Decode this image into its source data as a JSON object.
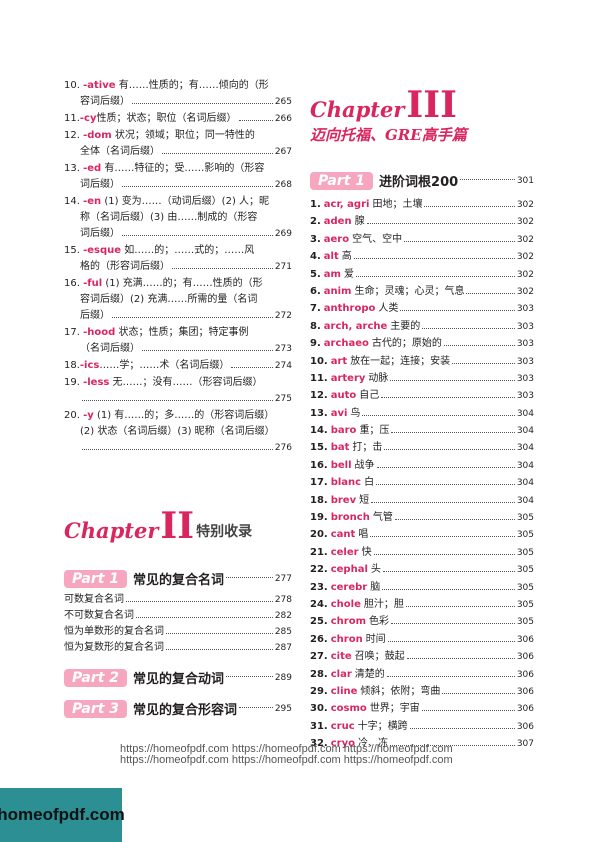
{
  "left_entries": [
    {
      "num": "10.",
      "affix": "-ative",
      "line1": "有……性质的；有……倾向的（形",
      "line2": "容词后缀）",
      "page": "265"
    },
    {
      "num": "11.",
      "affix": "-cy",
      "line1": "性质；状态；职位（名词后缀）",
      "line2": "",
      "page": "266"
    },
    {
      "num": "12.",
      "affix": "-dom",
      "line1": "状况；领域；职位；同一特性的",
      "line2": "全体（名词后缀）",
      "page": "267"
    },
    {
      "num": "13.",
      "affix": "-ed",
      "line1": "有……特征的；受……影响的（形容",
      "line2": "词后缀）",
      "page": "268"
    },
    {
      "num": "14.",
      "affix": "-en",
      "line1": "(1) 变为……（动词后缀）(2) 人；昵",
      "line2": "称（名词后缀）(3) 由……制成的（形容",
      "line3": "词后缀）",
      "page": "269"
    },
    {
      "num": "15.",
      "affix": "-esque",
      "line1": "如……的；……式的；……风",
      "line2": "格的（形容词后缀）",
      "page": "271"
    },
    {
      "num": "16.",
      "affix": "-ful",
      "line1": "(1) 充满……的；有……性质的（形",
      "line2": "容词后缀）(2) 充满……所需的量（名词",
      "line3": "后缀）",
      "page": "272"
    },
    {
      "num": "17.",
      "affix": "-hood",
      "line1": "状态；性质；集团；特定事例",
      "line2": "（名词后缀）",
      "page": "273"
    },
    {
      "num": "18.",
      "affix": "-ics",
      "line1": "……学；……术（名词后缀）",
      "line2": "",
      "page": "274"
    },
    {
      "num": "19.",
      "affix": "-less",
      "line1": "无……；没有……（形容词后缀）",
      "line2": "",
      "page": "275",
      "page_own_line": true
    },
    {
      "num": "20.",
      "affix": "-y",
      "line1": "(1) 有……的；多……的（形容词后缀）",
      "line2": "(2) 状态（名词后缀）(3) 昵称（名词后缀）",
      "line3": "",
      "page": "276",
      "page_own_line": true
    }
  ],
  "chapter2": {
    "word": "Chapter",
    "roman": "II",
    "sub": "特别收录"
  },
  "chapter2_parts": [
    {
      "badge": "Part 1",
      "title": "常见的复合名词",
      "page": "277",
      "items": [
        {
          "text": "可数复合名词",
          "page": "278"
        },
        {
          "text": "不可数复合名词",
          "page": "282"
        },
        {
          "text": "恒为单数形的复合名词",
          "page": "285"
        },
        {
          "text": "恒为复数形的复合名词",
          "page": "287"
        }
      ]
    },
    {
      "badge": "Part 2",
      "title": "常见的复合动词",
      "page": "289",
      "items": []
    },
    {
      "badge": "Part 3",
      "title": "常见的复合形容词",
      "page": "295",
      "items": []
    }
  ],
  "chapter3": {
    "word": "Chapter",
    "roman": "III",
    "sub": "迈向托福、GRE高手篇"
  },
  "chapter3_part": {
    "badge": "Part 1",
    "title": "进阶词根200",
    "page": "301"
  },
  "roots": [
    {
      "n": "1.",
      "root": "acr, agri",
      "meaning": "田地；土壤",
      "page": "302"
    },
    {
      "n": "2.",
      "root": "aden",
      "meaning": "腺",
      "page": "302"
    },
    {
      "n": "3.",
      "root": "aero",
      "meaning": "空气、空中",
      "page": "302"
    },
    {
      "n": "4.",
      "root": "alt",
      "meaning": "高",
      "page": "302"
    },
    {
      "n": "5.",
      "root": "am",
      "meaning": "爱",
      "page": "302"
    },
    {
      "n": "6.",
      "root": "anim",
      "meaning": "生命；灵魂；心灵；气息",
      "page": "302"
    },
    {
      "n": "7.",
      "root": "anthropo",
      "meaning": "人类",
      "page": "303"
    },
    {
      "n": "8.",
      "root": "arch, arche",
      "meaning": "主要的",
      "page": "303"
    },
    {
      "n": "9.",
      "root": "archaeo",
      "meaning": "古代的；原始的",
      "page": "303"
    },
    {
      "n": "10.",
      "root": "art",
      "meaning": "放在一起；连接；安装",
      "page": "303"
    },
    {
      "n": "11.",
      "root": "artery",
      "meaning": "动脉",
      "page": "303"
    },
    {
      "n": "12.",
      "root": "auto",
      "meaning": "自己",
      "page": "303"
    },
    {
      "n": "13.",
      "root": "avi",
      "meaning": "鸟",
      "page": "304"
    },
    {
      "n": "14.",
      "root": "baro",
      "meaning": "重；压",
      "page": "304"
    },
    {
      "n": "15.",
      "root": "bat",
      "meaning": "打；击",
      "page": "304"
    },
    {
      "n": "16.",
      "root": "bell",
      "meaning": "战争",
      "page": "304"
    },
    {
      "n": "17.",
      "root": "blanc",
      "meaning": "白",
      "page": "304"
    },
    {
      "n": "18.",
      "root": "brev",
      "meaning": "短",
      "page": "304"
    },
    {
      "n": "19.",
      "root": "bronch",
      "meaning": "气管",
      "page": "305"
    },
    {
      "n": "20.",
      "root": "cant",
      "meaning": "唱",
      "page": "305"
    },
    {
      "n": "21.",
      "root": "celer",
      "meaning": "快",
      "page": "305"
    },
    {
      "n": "22.",
      "root": "cephal",
      "meaning": "头",
      "page": "305"
    },
    {
      "n": "23.",
      "root": "cerebr",
      "meaning": "脑",
      "page": "305"
    },
    {
      "n": "24.",
      "root": "chole",
      "meaning": "胆汁；胆",
      "page": "305"
    },
    {
      "n": "25.",
      "root": "chrom",
      "meaning": "色彩",
      "page": "305"
    },
    {
      "n": "26.",
      "root": "chron",
      "meaning": "时间",
      "page": "306"
    },
    {
      "n": "27.",
      "root": "cite",
      "meaning": "召唤；鼓起",
      "page": "306"
    },
    {
      "n": "28.",
      "root": "clar",
      "meaning": "清楚的",
      "page": "306"
    },
    {
      "n": "29.",
      "root": "cline",
      "meaning": "倾斜；依附；弯曲",
      "page": "306"
    },
    {
      "n": "30.",
      "root": "cosmo",
      "meaning": "世界；宇宙",
      "page": "306"
    },
    {
      "n": "31.",
      "root": "cruc",
      "meaning": "十字；横跨",
      "page": "306"
    },
    {
      "n": "32.",
      "root": "cryo",
      "meaning": "冷、冻",
      "page": "307"
    }
  ],
  "watermark": {
    "line1": "https://homeofpdf.com https://homeofpdf.com https://homeofpdf.com",
    "line2": "https://homeofpdf.com https://homeofpdf.com https://homeofpdf.com",
    "logo": "homeofpdf.com"
  },
  "colors": {
    "accent": "#d9265f",
    "badge": "#f6a6be",
    "logo_bg": "#2b8f93"
  }
}
